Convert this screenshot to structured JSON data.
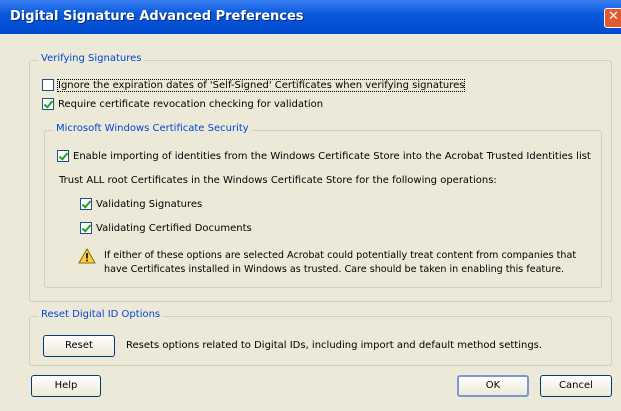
{
  "window": {
    "title": "Digital Signature Advanced Preferences"
  },
  "verifying": {
    "legend": "Verifying Signatures",
    "ignore_expiration": {
      "label": "Ignore the expiration dates of 'Self-Signed' Certificates when verifying signatures",
      "checked": false
    },
    "require_revocation": {
      "label": "Require certificate revocation checking for validation",
      "checked": true
    },
    "ms_security": {
      "legend": "Microsoft Windows Certificate Security",
      "enable_import": {
        "label": "Enable importing of identities from the Windows Certificate Store into the Acrobat Trusted Identities list",
        "checked": true
      },
      "trust_text": "Trust ALL root Certificates in the Windows Certificate Store for the following operations:",
      "validating_signatures": {
        "label": "Validating Signatures",
        "checked": true
      },
      "validating_certified": {
        "label": "Validating Certified Documents",
        "checked": true
      },
      "warning_line1": "If either of these options are selected Acrobat could potentially treat content from companies that",
      "warning_line2": "have Certificates installed in Windows as trusted. Care should be taken in enabling this feature."
    }
  },
  "reset_group": {
    "legend": "Reset Digital ID Options",
    "reset_label": "Reset",
    "reset_desc": "Resets options related to Digital IDs, including import and default method settings."
  },
  "buttons": {
    "help": "Help",
    "ok": "OK",
    "cancel": "Cancel"
  },
  "icons": {
    "warning": "warning-icon",
    "close": "close-icon"
  }
}
